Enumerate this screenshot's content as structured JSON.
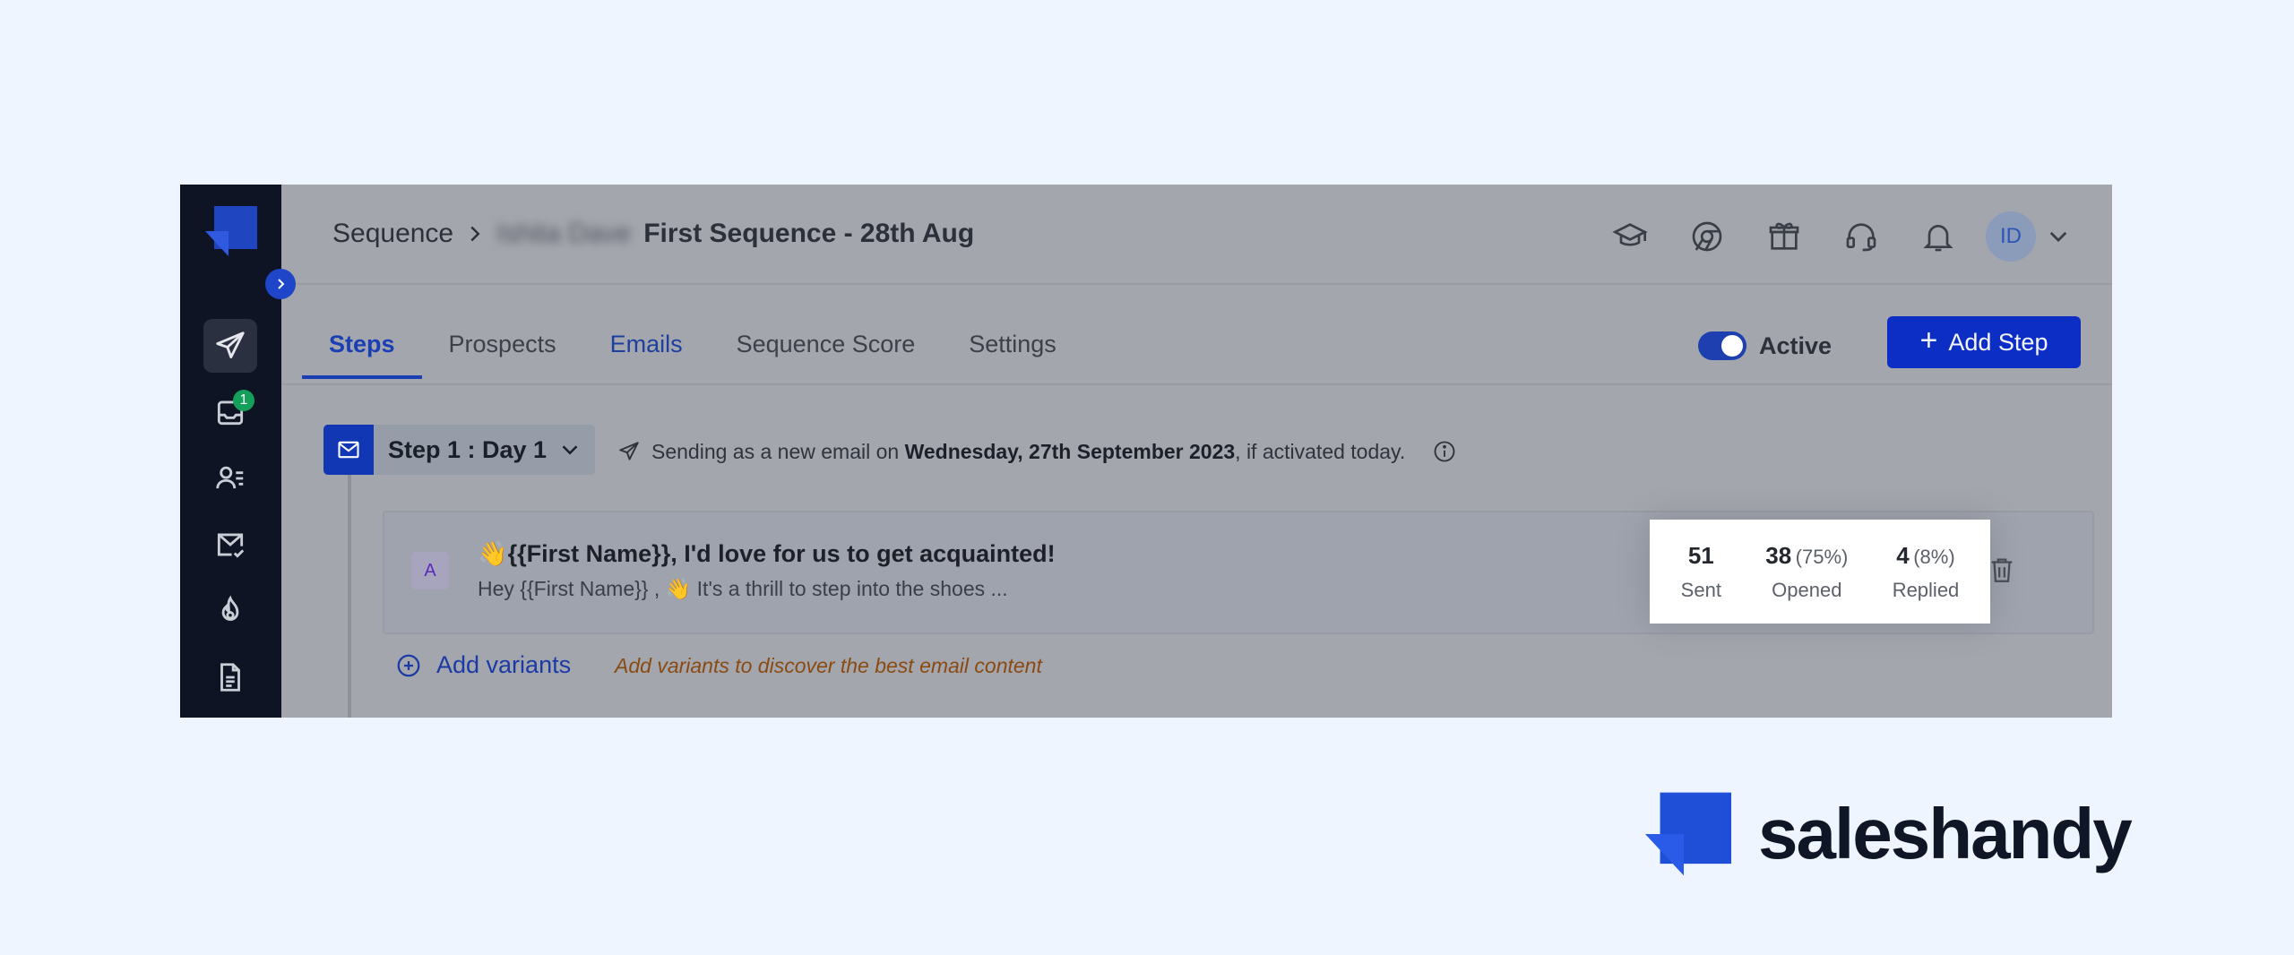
{
  "header": {
    "breadcrumb_root": "Sequence",
    "breadcrumb_owner": "Ishita Dave",
    "sequence_title": "First Sequence - 28th Aug",
    "avatar_initials": "ID"
  },
  "tabs": [
    {
      "label": "Steps"
    },
    {
      "label": "Prospects"
    },
    {
      "label": "Emails"
    },
    {
      "label": "Sequence Score"
    },
    {
      "label": "Settings"
    }
  ],
  "status": {
    "label": "Active",
    "on": true
  },
  "add_step_label": "Add Step",
  "sidebar": {
    "inbox_badge": "1"
  },
  "step": {
    "label": "Step 1 : Day 1",
    "info_prefix": "Sending as a new email on ",
    "info_date": "Wednesday, 27th September 2023",
    "info_suffix": ", if activated today."
  },
  "email": {
    "variant": "A",
    "subject": "👋{{First Name}}, I'd love for us to get acquainted!",
    "preview": "Hey {{First Name}} , 👋 It's a thrill to step into the shoes ..."
  },
  "stats": {
    "sent": {
      "value": "51",
      "label": "Sent"
    },
    "opened": {
      "value": "38",
      "pct": "(75%)",
      "label": "Opened"
    },
    "replied": {
      "value": "4",
      "pct": "(8%)",
      "label": "Replied"
    }
  },
  "add_variants": {
    "label": "Add variants",
    "hint": "Add variants to discover the best email content"
  },
  "brand": {
    "name": "saleshandy"
  },
  "colors": {
    "primary": "#1a3fb5",
    "sidebar": "#0e1424",
    "page_bg": "#eef5fe",
    "toggle": "#1d3fb0",
    "hint": "#8a4a12"
  }
}
